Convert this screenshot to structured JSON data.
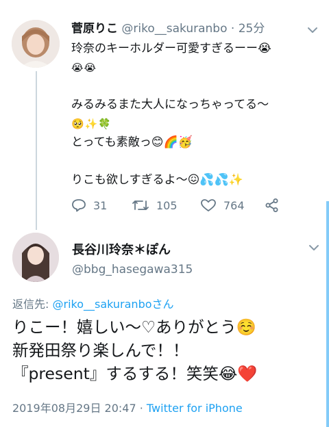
{
  "tweet1": {
    "display_name": "菅原りこ",
    "handle": "@riko__sakuranbo",
    "separator": "·",
    "time_ago": "25分",
    "lines": [
      "玲奈のキーホルダー可愛すぎるーー😭",
      "😭😭",
      "みるみるまた大人になっちゃってる〜",
      "🥺✨🍀",
      "とっても素敵っ😊🌈🥳",
      "りこも欲しすぎるよ〜😖💦💦✨"
    ],
    "replies": "31",
    "retweets": "105",
    "likes": "764"
  },
  "tweet2": {
    "display_name": "長谷川玲奈＊ぽん",
    "handle": "@bbg_hasegawa315",
    "reply_label": "返信先: ",
    "reply_target": "@riko__sakuranboさん",
    "lines": [
      "りこー！嬉しい〜♡ありがとう☺️",
      "新発田祭り楽しんで！！",
      "『present』するする！笑笑😂❤️"
    ],
    "timestamp": "2019年08月29日 20:47",
    "separator": " · ",
    "client": "Twitter for iPhone"
  },
  "icons": [
    "reply-icon",
    "retweet-icon",
    "like-icon",
    "share-icon",
    "chevron-down-icon"
  ],
  "colors": {
    "text": "#14171a",
    "secondary": "#657786",
    "link": "#1da1f2",
    "thread_line": "#ccd6dd"
  }
}
